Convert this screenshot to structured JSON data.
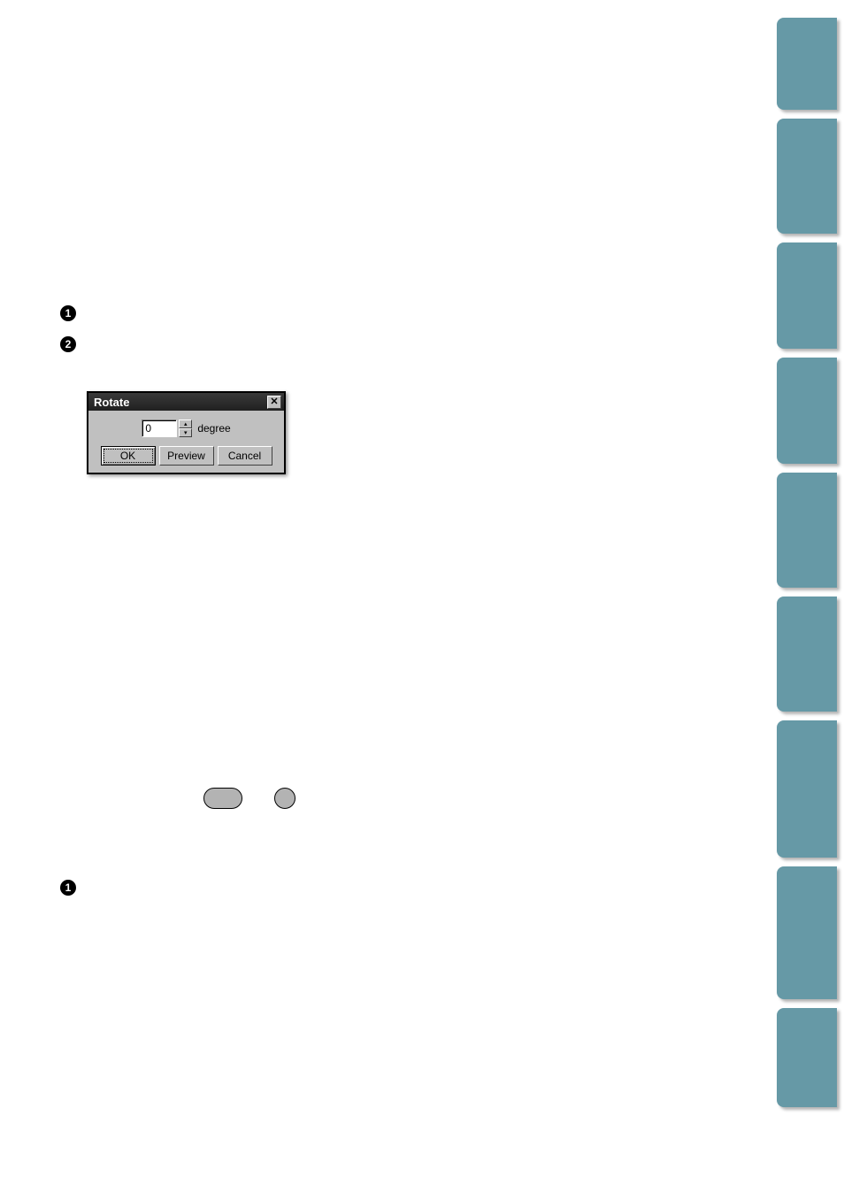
{
  "dialog": {
    "title": "Rotate",
    "close_glyph": "✕",
    "degree_value": "0",
    "degree_label": "degree",
    "spinner_up": "▴",
    "spinner_down": "▾",
    "ok_label": "OK",
    "preview_label": "Preview",
    "cancel_label": "Cancel"
  },
  "bullets": {
    "b1": "1",
    "b2": "2",
    "b3": "1"
  }
}
